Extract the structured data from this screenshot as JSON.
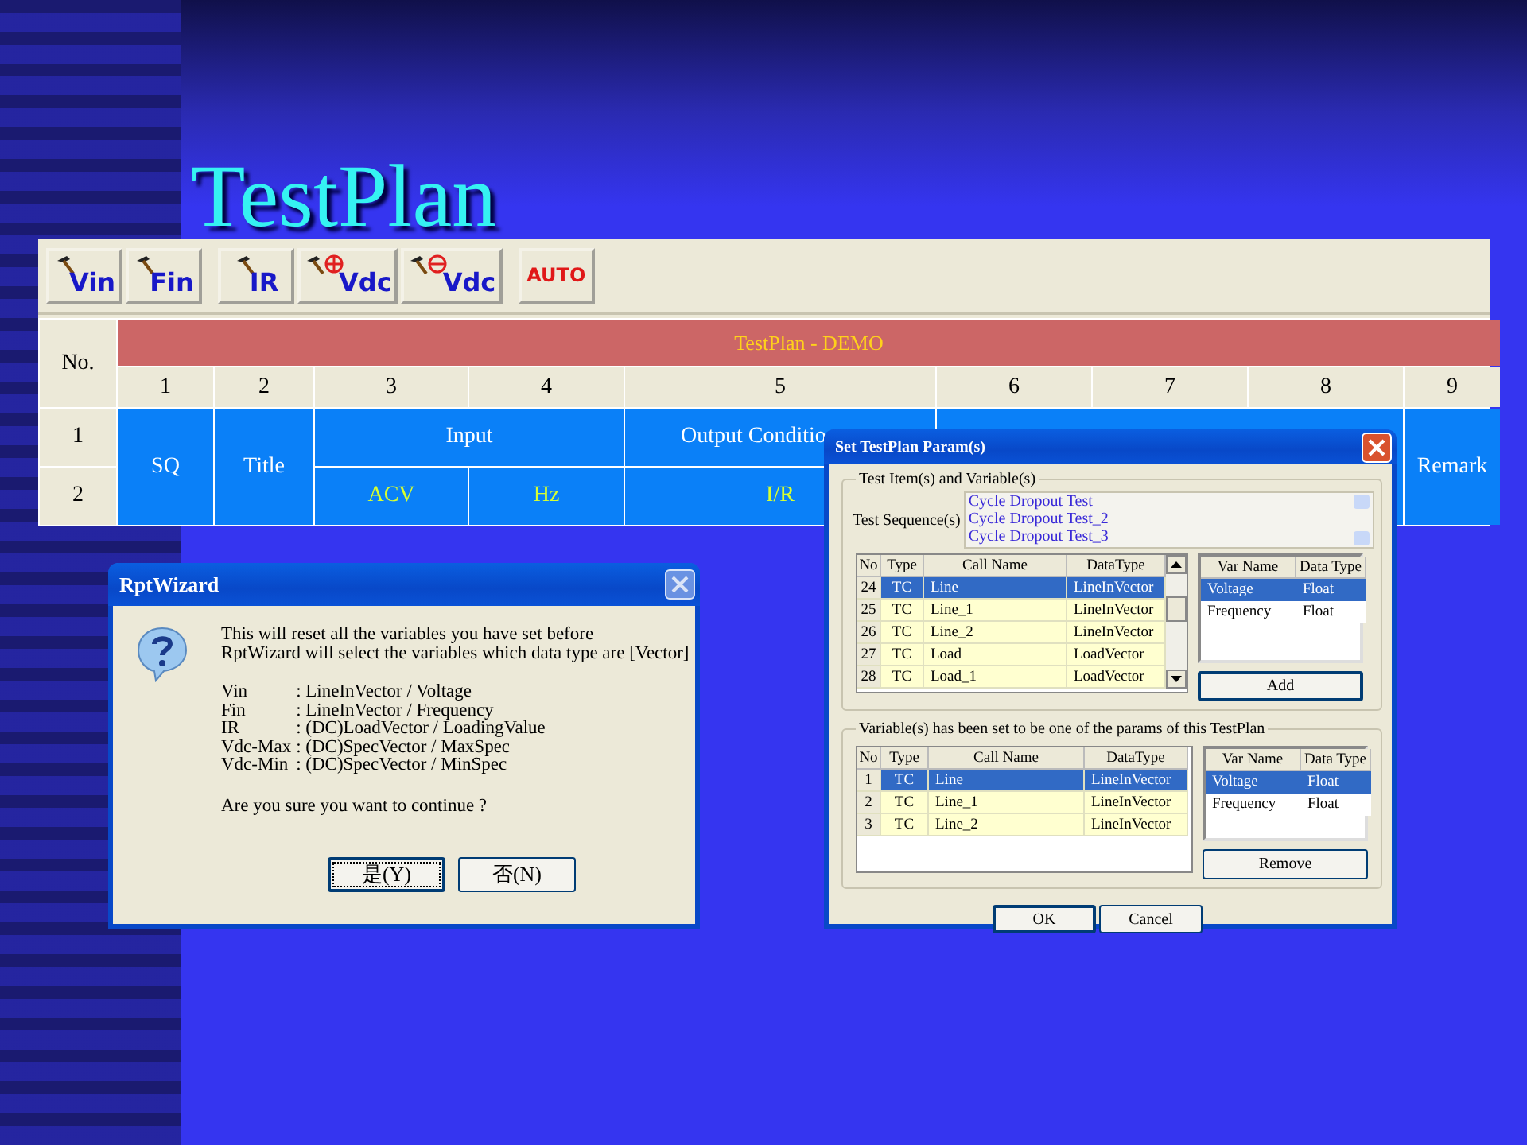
{
  "slide_title": "TestPlan",
  "toolbar": [
    {
      "label": "Vin",
      "kind": "hammer"
    },
    {
      "label": "Fin",
      "kind": "hammer"
    },
    {
      "label": "IR",
      "kind": "hammer"
    },
    {
      "label": "Vdc",
      "kind": "plus"
    },
    {
      "label": "Vdc",
      "kind": "minus"
    },
    {
      "label": "AUTO",
      "kind": "text"
    }
  ],
  "table": {
    "corner": "No.",
    "banner": "TestPlan - DEMO",
    "column_numbers": [
      "1",
      "2",
      "3",
      "4",
      "5",
      "6",
      "7",
      "8",
      "9"
    ],
    "row_numbers": [
      "1",
      "2"
    ],
    "cells": {
      "sq": "SQ",
      "title": "Title",
      "input": "Input",
      "acv": "ACV",
      "hz": "Hz",
      "output_condition": "Output Conditio",
      "ir": "I/R",
      "remark": "Remark"
    }
  },
  "wizard": {
    "title": "RptWizard",
    "close_disabled": true,
    "intro": [
      "This will reset all the variables you have set before",
      "RptWizard will select the variables which data type are [Vector]"
    ],
    "mappings": [
      {
        "name": "Vin",
        "value": ": LineInVector / Voltage"
      },
      {
        "name": "Fin",
        "value": ": LineInVector / Frequency"
      },
      {
        "name": "IR",
        "value": ": (DC)LoadVector / LoadingValue"
      },
      {
        "name": "Vdc-Max",
        "value": ": (DC)SpecVector / MaxSpec"
      },
      {
        "name": "Vdc-Min",
        "value": ": (DC)SpecVector / MinSpec"
      }
    ],
    "question": "Are you sure you want to continue ?",
    "buttons": [
      {
        "label": "是(Y)",
        "focused": true
      },
      {
        "label": "否(N)",
        "focused": false
      }
    ]
  },
  "params": {
    "title": "Set TestPlan Param(s)",
    "group_1": "Test Item(s) and Variable(s)",
    "sequence_label": "Test Sequence(s)",
    "sequences": [
      "Cycle Dropout Test",
      "Cycle Dropout Test_2",
      "Cycle Dropout Test_3"
    ],
    "items_columns": [
      "No",
      "Type",
      "Call Name",
      "DataType"
    ],
    "items": [
      {
        "cells": [
          "24",
          "TC",
          "Line",
          "LineInVector"
        ],
        "selected": true
      },
      {
        "cells": [
          "25",
          "TC",
          "Line_1",
          "LineInVector"
        ],
        "selected": false
      },
      {
        "cells": [
          "26",
          "TC",
          "Line_2",
          "LineInVector"
        ],
        "selected": false
      },
      {
        "cells": [
          "27",
          "TC",
          "Load",
          "LoadVector"
        ],
        "selected": false
      },
      {
        "cells": [
          "28",
          "TC",
          "Load_1",
          "LoadVector"
        ],
        "selected": false
      }
    ],
    "vars_columns": [
      "Var Name",
      "Data Type"
    ],
    "vars": [
      {
        "cells": [
          "Voltage",
          "Float"
        ],
        "selected": true
      },
      {
        "cells": [
          "Frequency",
          "Float"
        ],
        "selected": false
      }
    ],
    "add_button": "Add",
    "group_2": "Variable(s) has been set to be one of the params of this TestPlan",
    "set_columns": [
      "No",
      "Type",
      "Call Name",
      "DataType"
    ],
    "set_items": [
      {
        "cells": [
          "1",
          "TC",
          "Line",
          "LineInVector"
        ],
        "selected": true
      },
      {
        "cells": [
          "2",
          "TC",
          "Line_1",
          "LineInVector"
        ],
        "selected": false
      },
      {
        "cells": [
          "3",
          "TC",
          "Line_2",
          "LineInVector"
        ],
        "selected": false
      }
    ],
    "set_vars_columns": [
      "Var Name",
      "Data Type"
    ],
    "set_vars": [
      {
        "cells": [
          "Voltage",
          "Float"
        ],
        "selected": true
      },
      {
        "cells": [
          "Frequency",
          "Float"
        ],
        "selected": false
      }
    ],
    "remove_button": "Remove",
    "buttons": [
      "OK",
      "Cancel"
    ]
  }
}
